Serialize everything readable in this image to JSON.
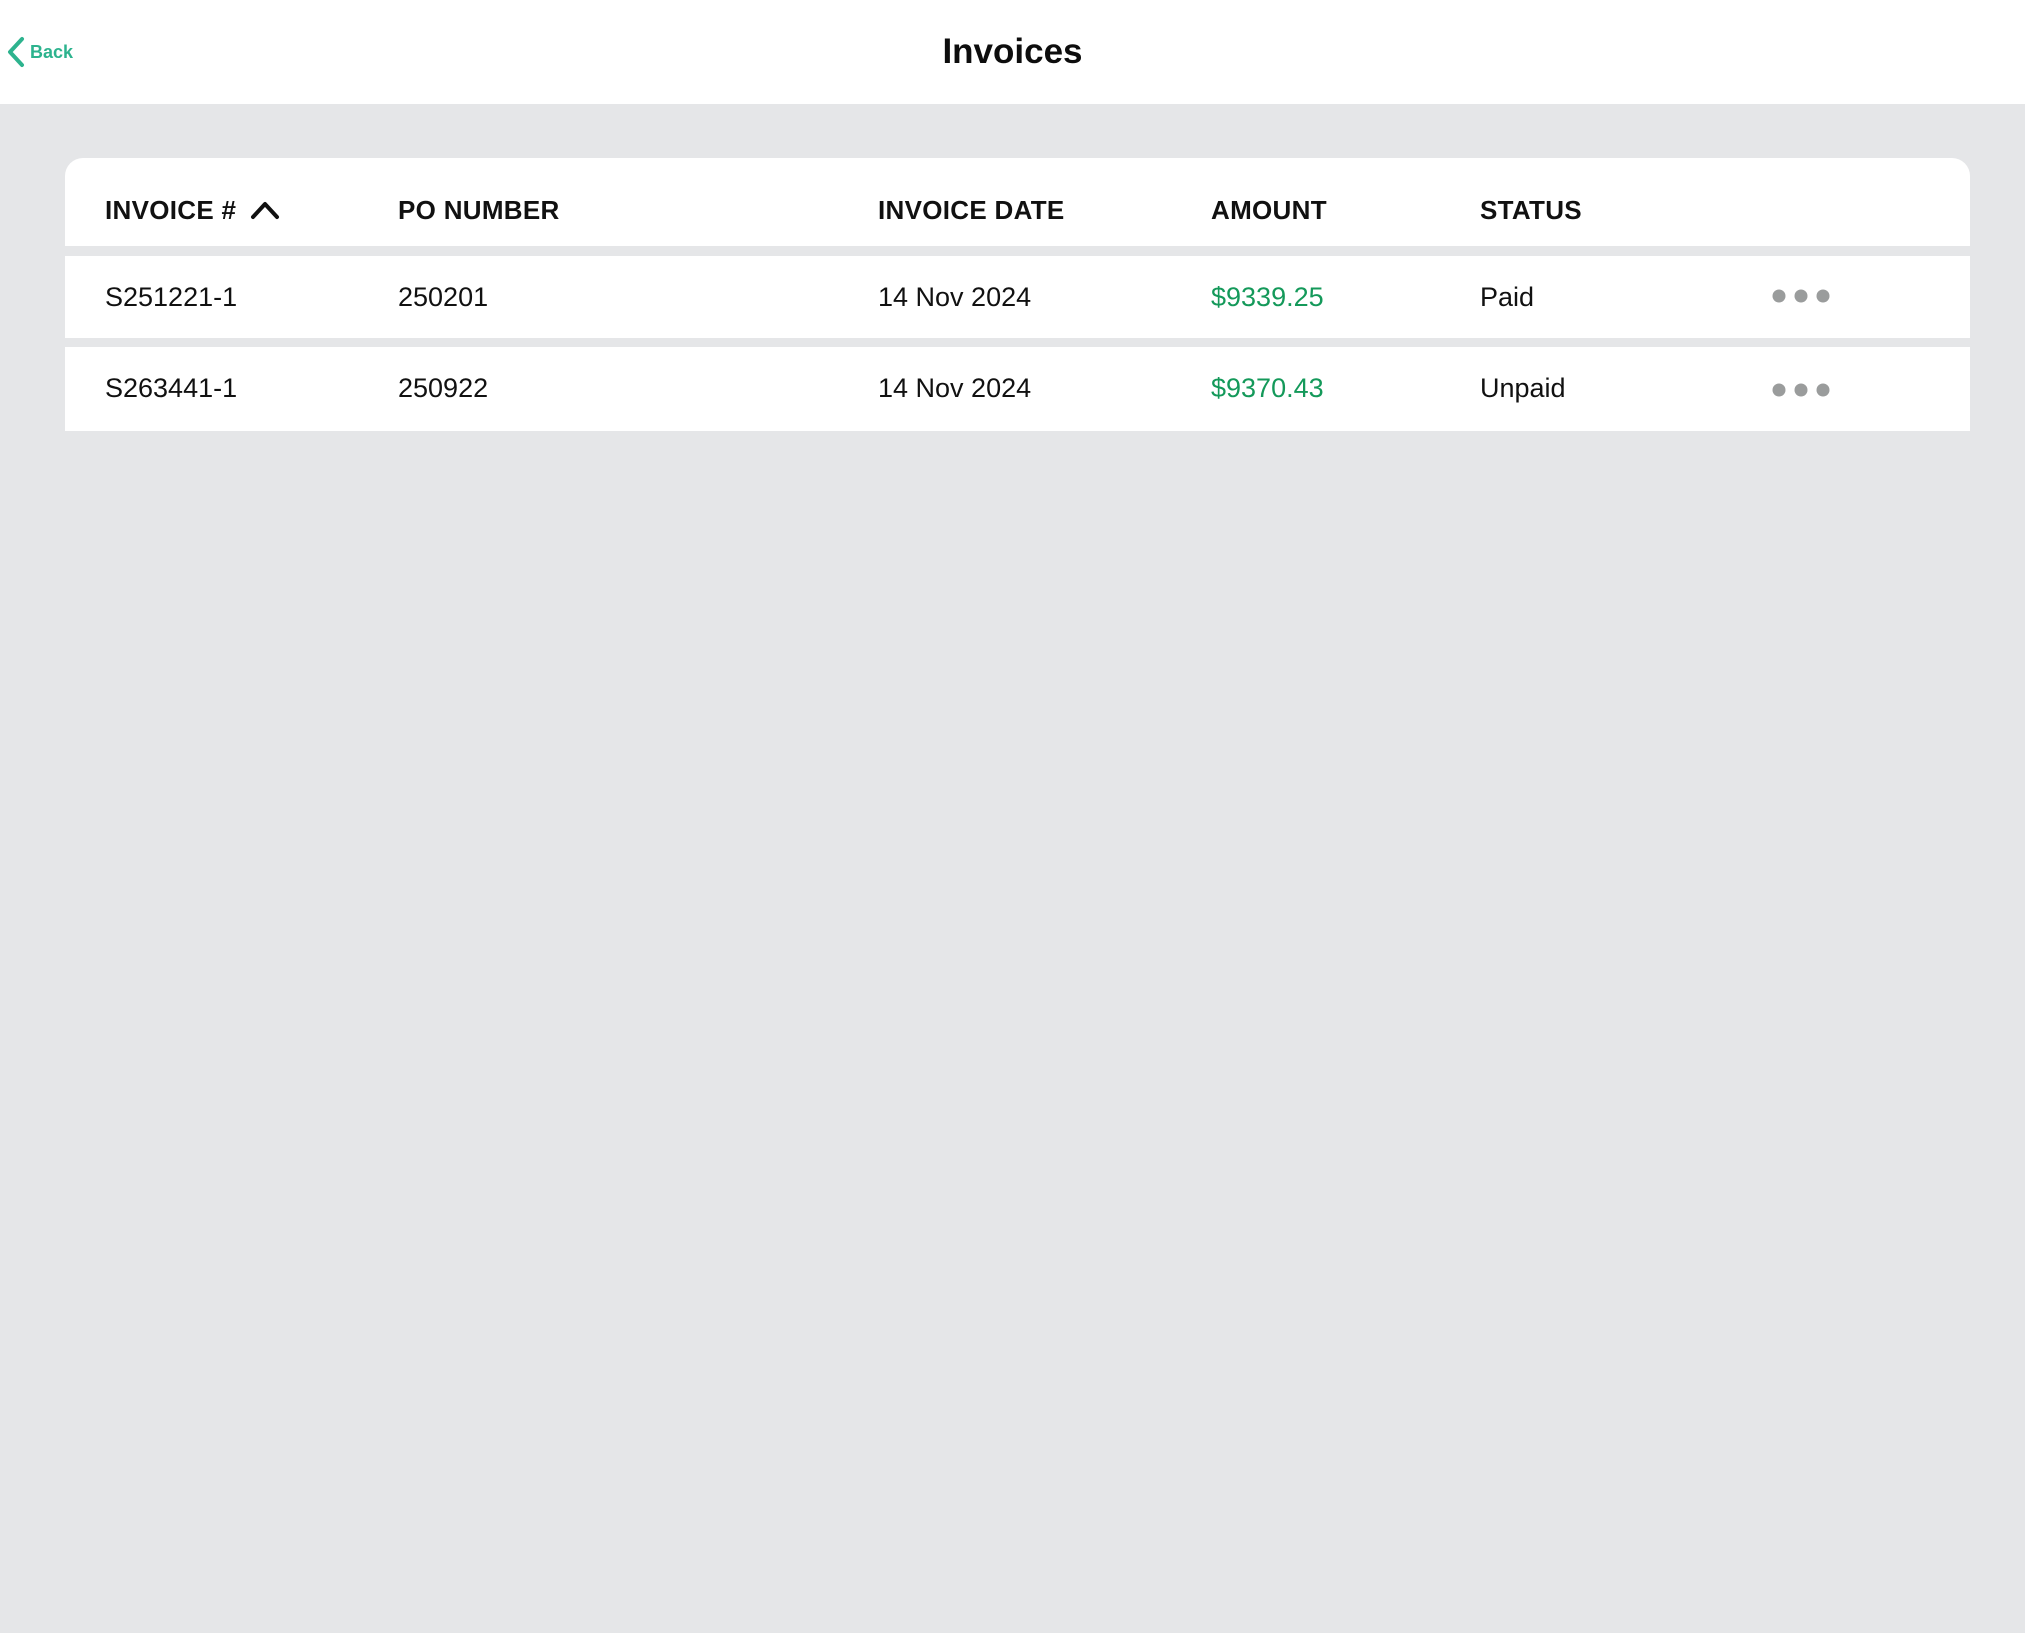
{
  "header": {
    "back_label": "Back",
    "title": "Invoices"
  },
  "table": {
    "columns": [
      "INVOICE #",
      "PO NUMBER",
      "INVOICE DATE",
      "AMOUNT",
      "STATUS"
    ],
    "sort": {
      "column": "INVOICE #",
      "direction": "ascending"
    },
    "rows": [
      {
        "invoice": "S251221-1",
        "po_number": "250201",
        "invoice_date": "14 Nov 2024",
        "amount": "$9339.25",
        "status": "Paid"
      },
      {
        "invoice": "S263441-1",
        "po_number": "250922",
        "invoice_date": "14 Nov 2024",
        "amount": "$9370.43",
        "status": "Unpaid"
      }
    ]
  },
  "icons": {
    "back": "chevron-left-icon",
    "sort": "chevron-up-icon",
    "row_menu": "more-horizontal-icon"
  },
  "colors": {
    "accent": "#2db38e",
    "amount": "#14995a",
    "background": "#e5e6e8",
    "menu_dots": "#9a9c9c"
  }
}
